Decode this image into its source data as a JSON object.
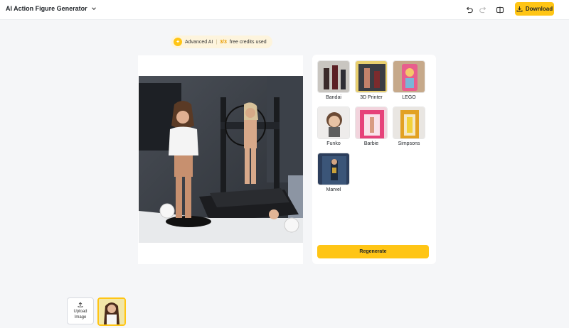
{
  "app": {
    "title": "AI Action Figure Generator"
  },
  "toolbar": {
    "undo_icon": "undo-icon",
    "redo_icon": "redo-icon",
    "compare_icon": "compare-icon",
    "download_label": "Download"
  },
  "credits": {
    "label": "Advanced AI",
    "count": "3/3",
    "suffix": "free credits used"
  },
  "styles": [
    {
      "label": "Bandai"
    },
    {
      "label": "3D Printer"
    },
    {
      "label": "LEGO"
    },
    {
      "label": "Funko"
    },
    {
      "label": "Barbie"
    },
    {
      "label": "Simpsons"
    },
    {
      "label": "Marvel"
    }
  ],
  "actions": {
    "regenerate_label": "Regenerate"
  },
  "upload": {
    "label_line1": "Upload",
    "label_line2": "Image"
  },
  "colors": {
    "accent": "#ffc515",
    "background": "#f5f6f8"
  }
}
